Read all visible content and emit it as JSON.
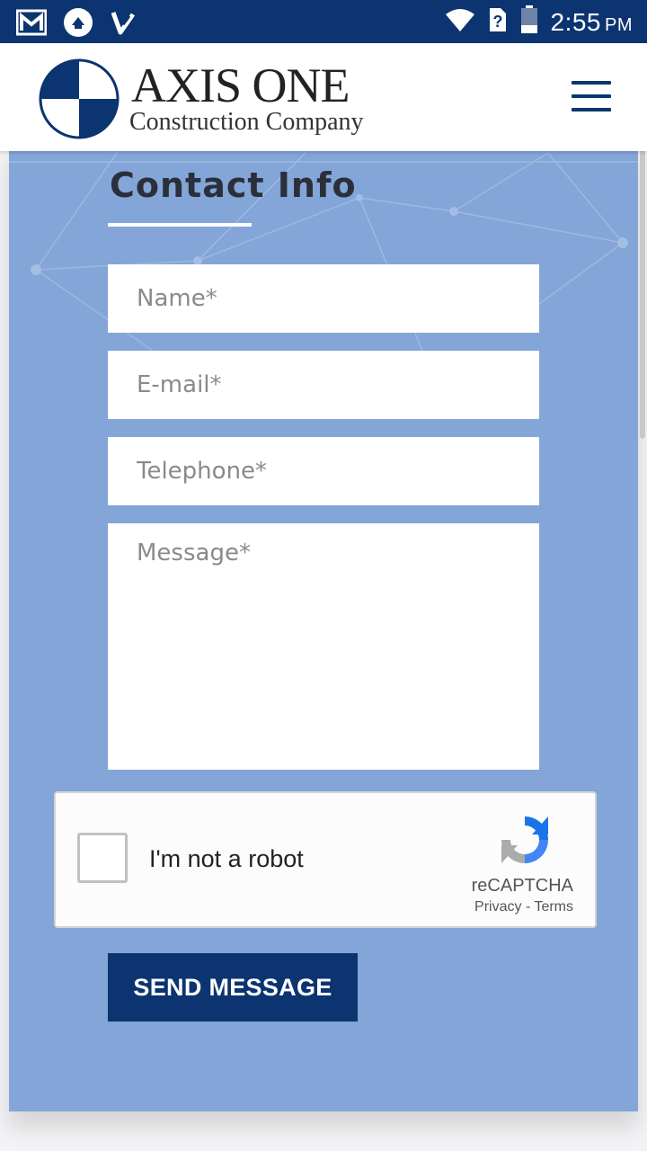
{
  "status_bar": {
    "time": "2:55",
    "ampm": "PM",
    "icons": [
      "gmail-icon",
      "app-icon",
      "checkmark-app-icon",
      "wifi-icon",
      "no-sim-icon",
      "battery-icon"
    ]
  },
  "header": {
    "logo_title": "AXIS ONE",
    "logo_subtitle": "Construction Company",
    "menu_icon": "hamburger-menu-icon"
  },
  "contact": {
    "heading": "Contact Info",
    "fields": {
      "name_placeholder": "Name*",
      "email_placeholder": "E-mail*",
      "telephone_placeholder": "Telephone*",
      "message_placeholder": "Message*"
    },
    "recaptcha": {
      "label": "I'm not a robot",
      "brand": "reCAPTCHA",
      "privacy": "Privacy",
      "separator": " - ",
      "terms": "Terms"
    },
    "submit_label": "SEND MESSAGE"
  },
  "colors": {
    "brand_navy": "#0b3470",
    "card_blue": "#83a5d8",
    "heading": "#2b2f3a"
  }
}
